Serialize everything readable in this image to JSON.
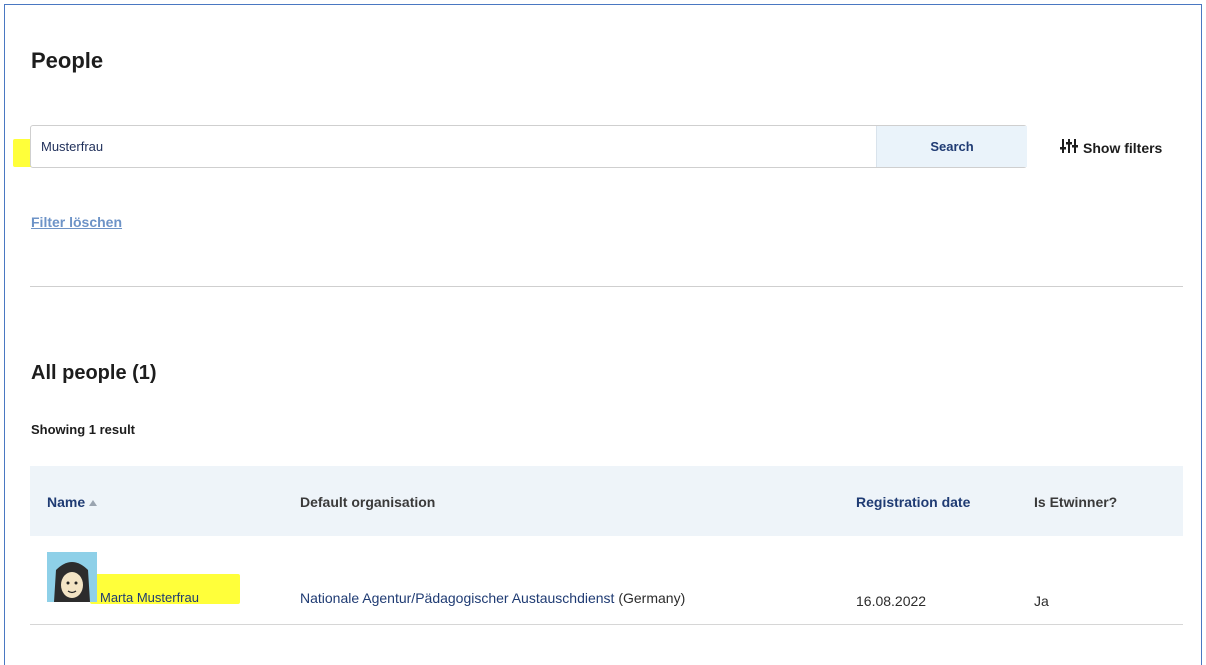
{
  "page": {
    "title": "People"
  },
  "search": {
    "value": "Musterfrau",
    "button_label": "Search"
  },
  "filters": {
    "show_label": "Show filters",
    "clear_label": "Filter löschen"
  },
  "results": {
    "title": "All people (1)",
    "count_text": "Showing 1 result"
  },
  "table": {
    "columns": {
      "name": "Name",
      "organisation": "Default organisation",
      "registration_date": "Registration date",
      "is_etwinner": "Is Etwinner?"
    },
    "rows": [
      {
        "name": "Marta Musterfrau",
        "organisation": "Nationale Agentur/Pädagogischer Austauschdienst",
        "country": "(Germany)",
        "registration_date": "16.08.2022",
        "is_etwinner": "Ja"
      }
    ]
  },
  "colors": {
    "accent": "#1f3b73",
    "link": "#6d93c7",
    "highlight": "#ffff3a",
    "header_bg": "#eef4f9"
  },
  "icons": {
    "filter": "sliders-icon",
    "sort": "sort-up-icon",
    "avatar": "user-avatar-icon"
  }
}
